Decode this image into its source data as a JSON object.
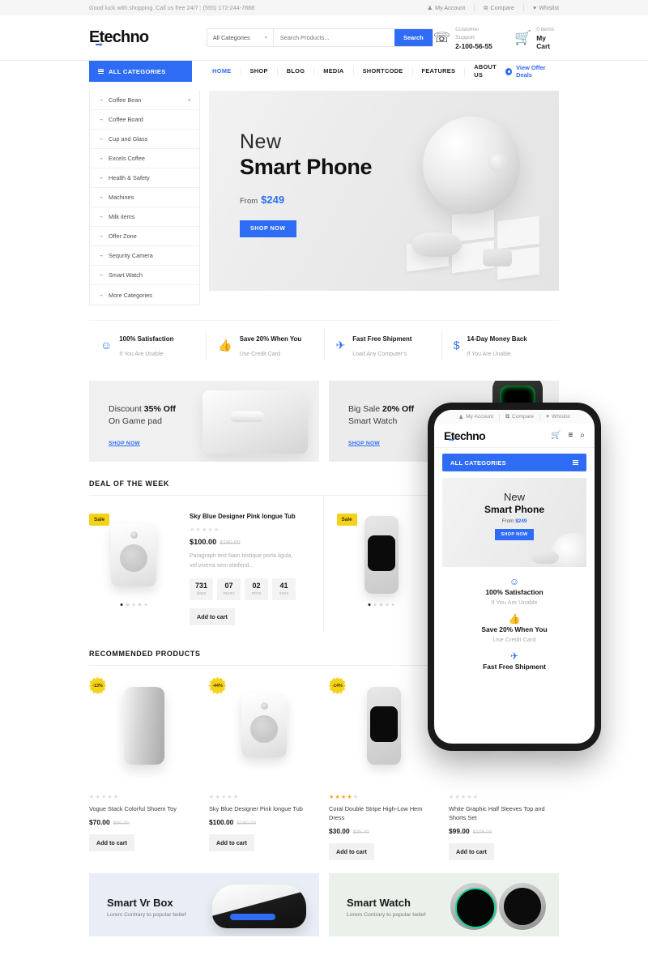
{
  "topbar": {
    "message": "Good luck with shopping. Call us free 24/7 : (555) 172-244-7888",
    "links": [
      {
        "label": "My Account",
        "icon": "user-icon",
        "glyph": "♟"
      },
      {
        "label": "Compare",
        "icon": "compare-icon",
        "glyph": "⧉"
      },
      {
        "label": "Whislist",
        "icon": "heart-icon",
        "glyph": "♥"
      }
    ]
  },
  "header": {
    "logo": "Etechno",
    "search": {
      "category_label": "All Categories",
      "caret": "▾",
      "placeholder": "Search Products...",
      "button_label": "Search"
    },
    "support": {
      "icon": "headset-icon",
      "label": "Customer Support",
      "phone": "2-100-56-55"
    },
    "cart": {
      "icon": "cart-icon",
      "count_label": "0 items",
      "label": "My Cart"
    }
  },
  "nav": {
    "all_categories": "ALL CATEGORIES",
    "links": [
      {
        "label": "HOME",
        "active": true
      },
      {
        "label": "SHOP",
        "active": false
      },
      {
        "label": "BLOG",
        "active": false
      },
      {
        "label": "MEDIA",
        "active": false
      },
      {
        "label": "SHORTCODE",
        "active": false
      },
      {
        "label": "FEATURES",
        "active": false
      },
      {
        "label": "ABOUT US",
        "active": false
      }
    ],
    "offer_deals": "View Offer Deals"
  },
  "categories": [
    {
      "label": "Coffee Bean",
      "expandable": "+"
    },
    {
      "label": "Coffee Board",
      "expandable": ""
    },
    {
      "label": "Cup and Glass",
      "expandable": ""
    },
    {
      "label": "Excels Coffee",
      "expandable": ""
    },
    {
      "label": "Health & Safety",
      "expandable": ""
    },
    {
      "label": "Machines",
      "expandable": ""
    },
    {
      "label": "Milk items",
      "expandable": ""
    },
    {
      "label": "Offer Zone",
      "expandable": ""
    },
    {
      "label": "Sequrity Camera",
      "expandable": ""
    },
    {
      "label": "Smart Watch",
      "expandable": ""
    },
    {
      "label": "More Categories",
      "expandable": ""
    }
  ],
  "hero": {
    "eyebrow": "New",
    "title": "Smart Phone",
    "from_label": "From",
    "price": "$249",
    "button": "SHOP NOW"
  },
  "features": [
    {
      "icon": "smiley-icon",
      "glyph": "☺",
      "title": "100% Satisfaction",
      "subtitle": "If You Are Unable"
    },
    {
      "icon": "thumbs-up-icon",
      "glyph": "👍",
      "title": "Save 20% When You",
      "subtitle": "Use Credit Card"
    },
    {
      "icon": "airplane-icon",
      "glyph": "✈",
      "title": "Fast Free Shipment",
      "subtitle": "Load Any Computer's"
    },
    {
      "icon": "dollar-icon",
      "glyph": "$",
      "title": "14-Day Money Back",
      "subtitle": "If You Are Unable"
    }
  ],
  "promos": [
    {
      "line1_prefix": "Discount ",
      "line1_strong": "35% Off",
      "line2": "On Game pad",
      "link": "SHOP NOW"
    },
    {
      "line1_prefix": "Big Sale ",
      "line1_strong": "20% Off",
      "line2": "Smart Watch",
      "link": "SHOP NOW"
    }
  ],
  "deal_section": {
    "heading": "DEAL OF THE WEEK",
    "items": [
      {
        "badge": "Sale",
        "title": "Sky Blue Designer Pink longue Tub",
        "rating": 0,
        "price": "$100.00",
        "old_price": "$180.00",
        "description": "Paragraph text Nam tristique porta ligula, vel viverra sem eleifend...",
        "counter": [
          {
            "value": "731",
            "unit": "days"
          },
          {
            "value": "07",
            "unit": "hours"
          },
          {
            "value": "02",
            "unit": "mins"
          },
          {
            "value": "41",
            "unit": "secs"
          }
        ],
        "button": "Add to cart"
      },
      {
        "badge": "Sale"
      }
    ]
  },
  "recommended": {
    "heading": "RECOMMENDED PRODUCTS",
    "products": [
      {
        "discount": "-13%",
        "rating": 0,
        "name": "Vogue Stack Colorful Shoem Toy",
        "price": "$70.00",
        "old_price": "$80.00",
        "button": "Add to cart"
      },
      {
        "discount": "-44%",
        "rating": 0,
        "name": "Sky Blue Designer Pink longue Tub",
        "price": "$100.00",
        "old_price": "$180.00",
        "button": "Add to cart"
      },
      {
        "discount": "-14%",
        "rating": 4,
        "name": "Coral Double Stripe High-Low Hem Dress",
        "price": "$30.00",
        "old_price": "$35.00",
        "button": "Add to cart"
      },
      {
        "discount": "",
        "rating": 0,
        "name": "White Graphic Half Sleeves Top and Shorts Set",
        "price": "$99.00",
        "old_price": "$105.00",
        "button": "Add to cart"
      }
    ]
  },
  "bottom_banners": [
    {
      "title": "Smart Vr Box",
      "subtitle": "Lorem Contrary to popular belief"
    },
    {
      "title": "Smart Watch",
      "subtitle": "Lorem Contrary to popular belief"
    }
  ],
  "phone_mockup": {
    "topbar": [
      {
        "label": "My Account",
        "glyph": "♟"
      },
      {
        "label": "Compare",
        "glyph": "⧉"
      },
      {
        "label": "Whislist",
        "glyph": "♥"
      }
    ],
    "logo": "Etechno",
    "icons": [
      {
        "name": "cart-icon",
        "glyph": "🛒"
      },
      {
        "name": "menu-icon",
        "glyph": "≡"
      },
      {
        "name": "search-icon",
        "glyph": "⌕"
      }
    ],
    "all_categories": "ALL CATEGORIES",
    "hero": {
      "eyebrow": "New",
      "title": "Smart Phone",
      "from_label": "From",
      "price": "$249",
      "button": "SHOP NOW"
    },
    "features": [
      {
        "glyph": "☺",
        "title": "100% Satisfaction",
        "subtitle": "If You Are Unable"
      },
      {
        "glyph": "👍",
        "title": "Save 20% When You",
        "subtitle": "Use Credit Card"
      },
      {
        "glyph": "✈",
        "title": "Fast Free Shipment",
        "subtitle": ""
      }
    ]
  },
  "colors": {
    "accent": "#2f6cf6",
    "badge": "#f5d21a",
    "star": "#f0a81e",
    "text": "#141414"
  }
}
